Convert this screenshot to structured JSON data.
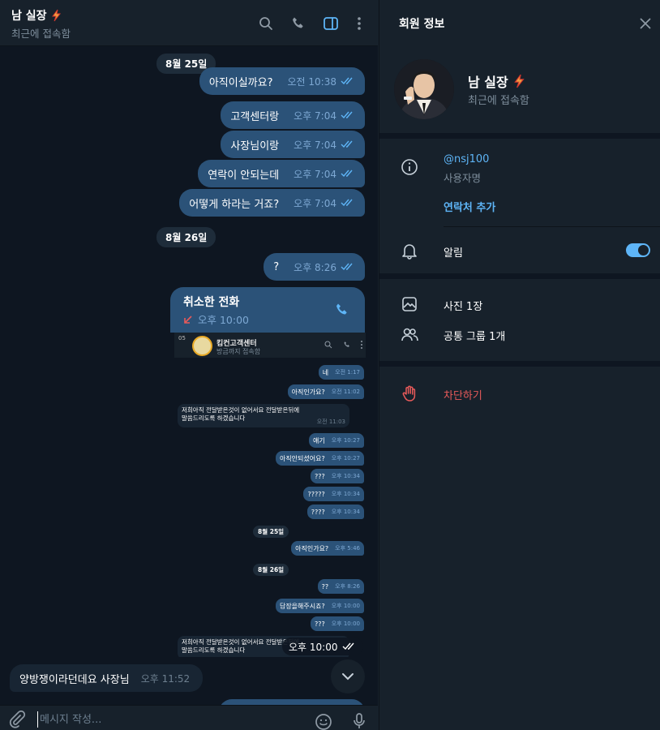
{
  "chat": {
    "title": "남 실장",
    "status": "최근에 접속함",
    "dates": [
      "8월 25일",
      "8월 26일"
    ],
    "outgoing": [
      {
        "text": "아직이실까요?",
        "time": "오전 10:38"
      },
      {
        "text": "고객센터랑",
        "time": "오후 7:04"
      },
      {
        "text": "사장님이랑",
        "time": "오후 7:04"
      },
      {
        "text": "연락이 안되는데",
        "time": "오후 7:04"
      },
      {
        "text": "어떻게 하라는 거죠?",
        "time": "오후 7:04"
      },
      {
        "text": "?",
        "time": "오후 8:26"
      }
    ],
    "call": {
      "title": "취소한 전화",
      "time": "오후 10:00"
    },
    "image_time": "오후 10:00",
    "incoming": {
      "text": "양방쟁이라던데요 사장님",
      "time": "오후 11:52"
    },
    "composer_placeholder": "메시지 작성..."
  },
  "screenshot": {
    "title": "킴컨고객센터",
    "status": "방금까지 접속함",
    "badge": "05",
    "out1": {
      "text": "네",
      "time": "오전 1:17"
    },
    "out2": {
      "text": "아직인가요?",
      "time": "오전 11:02"
    },
    "in1": {
      "line1": "저희아직 전달받은것이 없어서요 전달받은뒤에",
      "line2": "말씀드리도록 하겠습니다",
      "time": "오전 11:03"
    },
    "out3": {
      "text": "얘기",
      "time": "오후 10:27"
    },
    "out4": {
      "text": "아직안되셨어요?",
      "time": "오후 10:27"
    },
    "out5": {
      "text": "???",
      "time": "오후 10:34"
    },
    "out6": {
      "text": "?????",
      "time": "오후 10:34"
    },
    "out7": {
      "text": "????",
      "time": "오후 10:34"
    },
    "date1": "8월 25일",
    "out8": {
      "text": "아직인가요?",
      "time": "오후 5:46"
    },
    "date2": "8월 26일",
    "out9": {
      "text": "??",
      "time": "오후 8:26"
    },
    "out10": {
      "text": "답장을해주시죠?",
      "time": "오후 10:00"
    },
    "out11": {
      "text": "???",
      "time": "오후 10:00"
    },
    "in2": {
      "line1": "저희아직 전달받은것이 없어서요 전달받은뒤에",
      "line2": "말씀드리도록 하겠습니다"
    }
  },
  "panel": {
    "title": "회원 정보",
    "name": "남 실장",
    "status": "최근에 접속함",
    "username": "@nsj100",
    "username_label": "사용자명",
    "add_contact": "연락처 추가",
    "notifications": "알림",
    "notifications_on": true,
    "photos": "사진 1장",
    "groups": "공통 그룹 1개",
    "block": "차단하기"
  },
  "colors": {
    "accent": "#5eb5f7",
    "outgoing_bubble": "#2b5278",
    "danger": "#e85a5a",
    "chat_bg": "#0e1621",
    "panel_bg": "#17212b"
  },
  "icons": [
    "search-icon",
    "phone-icon",
    "sidebar-toggle-icon",
    "more-icon",
    "close-icon",
    "info-icon",
    "bell-icon",
    "photo-icon",
    "users-icon",
    "hand-icon",
    "paperclip-icon",
    "emoji-icon",
    "mic-icon",
    "chevron-down-icon",
    "missed-call-icon",
    "lightning-icon",
    "double-check-icon"
  ]
}
